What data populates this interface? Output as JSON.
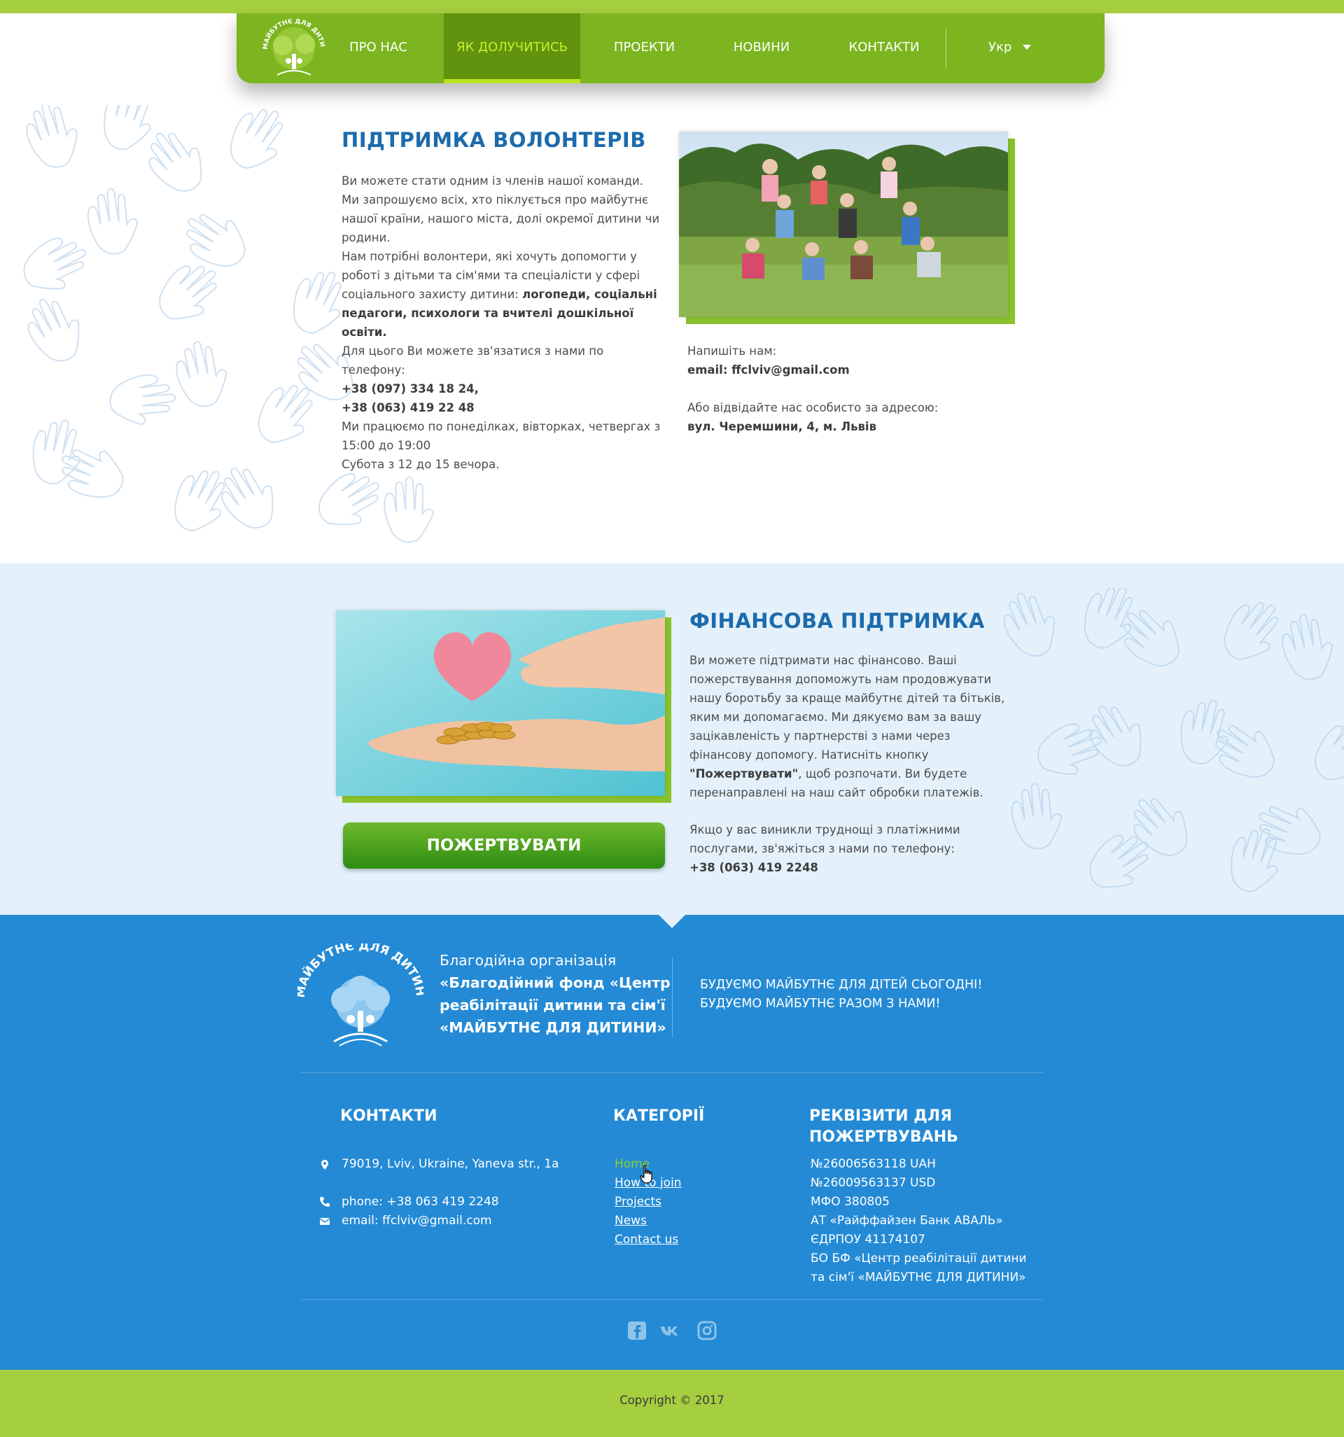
{
  "nav": {
    "items": [
      {
        "label": "ПРО НАС"
      },
      {
        "label": "ЯК ДОЛУЧИТИСЬ"
      },
      {
        "label": "ПРОЕКТИ"
      },
      {
        "label": "НОВИНИ"
      },
      {
        "label": "КОНТАКТИ"
      }
    ],
    "language": "Укр",
    "logo_text": "МАЙБУТНЄ ДЛЯ ДИТИНИ"
  },
  "volunteer": {
    "title": "ПІДТРИМКА ВОЛОНТЕРІВ",
    "p1_line1": "Ви можете стати одним із членів нашої команди.",
    "p1_line2": "Ми запрошуємо всіх, хто піклується про майбутнє нашої країни, нашого міста,  долі окремої дитини чи родини.",
    "p1_line3": "Нам потрібні волонтери, які хочуть допомогти у роботі з дітьми та сім'ями та спеціалісти у сфері соціального захисту дитини: ",
    "p1_bold": "логопеди, соціальні педагоги, психологи та вчителі дошкільної освіти.",
    "phone_intro": "Для цього Ви можете зв'язатися з нами по телефону:",
    "phone1": "+38 (097) 334 18 24,",
    "phone2": "+38 (063) 419 22 48",
    "hours1": "Ми працюємо по понеділках, вівторках, четвергах з 15:00 до 19:00",
    "hours2": "Субота з 12 до 15 вечора.",
    "write_us": "Напишіть нам:",
    "email": "email: ffclviv@gmail.com",
    "visit": "Або відвідайте нас особисто за адресою:",
    "address": "вул. Черемшини, 4, м. Львів"
  },
  "finance": {
    "title": "ФІНАНСОВА ПІДТРИМКА",
    "p1_a": "Ви можете підтримати нас фінансово. Ваші пожерствування допоможуть нам продовжувати нашу боротьбу за краще майбутнє дітей та бітьків, яким ми допомагаємо. Ми дякуємо вам за вашу зацікавленість у партнерстві з нами через фінансову допомогу. Натисніть кнопку ",
    "p1_bold": "\"Пожертвувати\"",
    "p1_b": ", щоб розпочати. Ви будете перенаправлені на наш сайт обробки платежів.",
    "p2": "Якщо у вас виникли труднощі з платіжними послугами, зв'яжіться з нами по телефону:",
    "phone": "+38 (063) 419 2248",
    "button": "ПОЖЕРТВУВАТИ"
  },
  "footer": {
    "logo_text": "МАЙБУТНЄ ДЛЯ ДИТИНИ",
    "org_line1": "Благодійна організація",
    "org_line2": "«Благодійний фонд «Центр реабілітації дитини та сім'ї «МАЙБУТНЄ ДЛЯ ДИТИНИ»",
    "slogan1": "БУДУЄМО МАЙБУТНЄ ДЛЯ ДІТЕЙ СЬОГОДНІ!",
    "slogan2": "БУДУЄМО МАЙБУТНЄ РАЗОМ З НАМИ!",
    "contacts_title": "КОНТАКТИ",
    "address": "79019, Lviv, Ukraine, Yaneva str., 1a",
    "phone": "phone: +38 063 419 2248",
    "email": "email: ffclviv@gmail.com",
    "categories_title": "КАТЕГОРІЇ",
    "categories": [
      {
        "label": "Home"
      },
      {
        "label": "How to join"
      },
      {
        "label": "Projects"
      },
      {
        "label": "News"
      },
      {
        "label": "Contact us"
      }
    ],
    "requisites_title": "РЕКВІЗИТИ ДЛЯ ПОЖЕРТВУВАНЬ",
    "requisites": [
      "№26006563118  UAH",
      "№26009563137 USD",
      "МФО 380805",
      "АТ «Райффайзен Банк АВАЛЬ»",
      "ЄДРПОУ 41174107",
      "БО БФ «Центр реабілітації дитини",
      "та сім'ї «МАЙБУТНЄ ДЛЯ ДИТИНИ»"
    ],
    "copyright": "Copyright © 2017"
  },
  "colors": {
    "nav_green": "#7cb51f",
    "active_green": "#62930f",
    "title_blue": "#1d6bab",
    "footer_blue": "#248ad5",
    "bar_green": "#a6cf3f"
  },
  "icons": [
    "map-pin-icon",
    "phone-icon",
    "envelope-icon",
    "facebook-icon",
    "vk-icon",
    "instagram-icon",
    "caret-down-icon"
  ]
}
